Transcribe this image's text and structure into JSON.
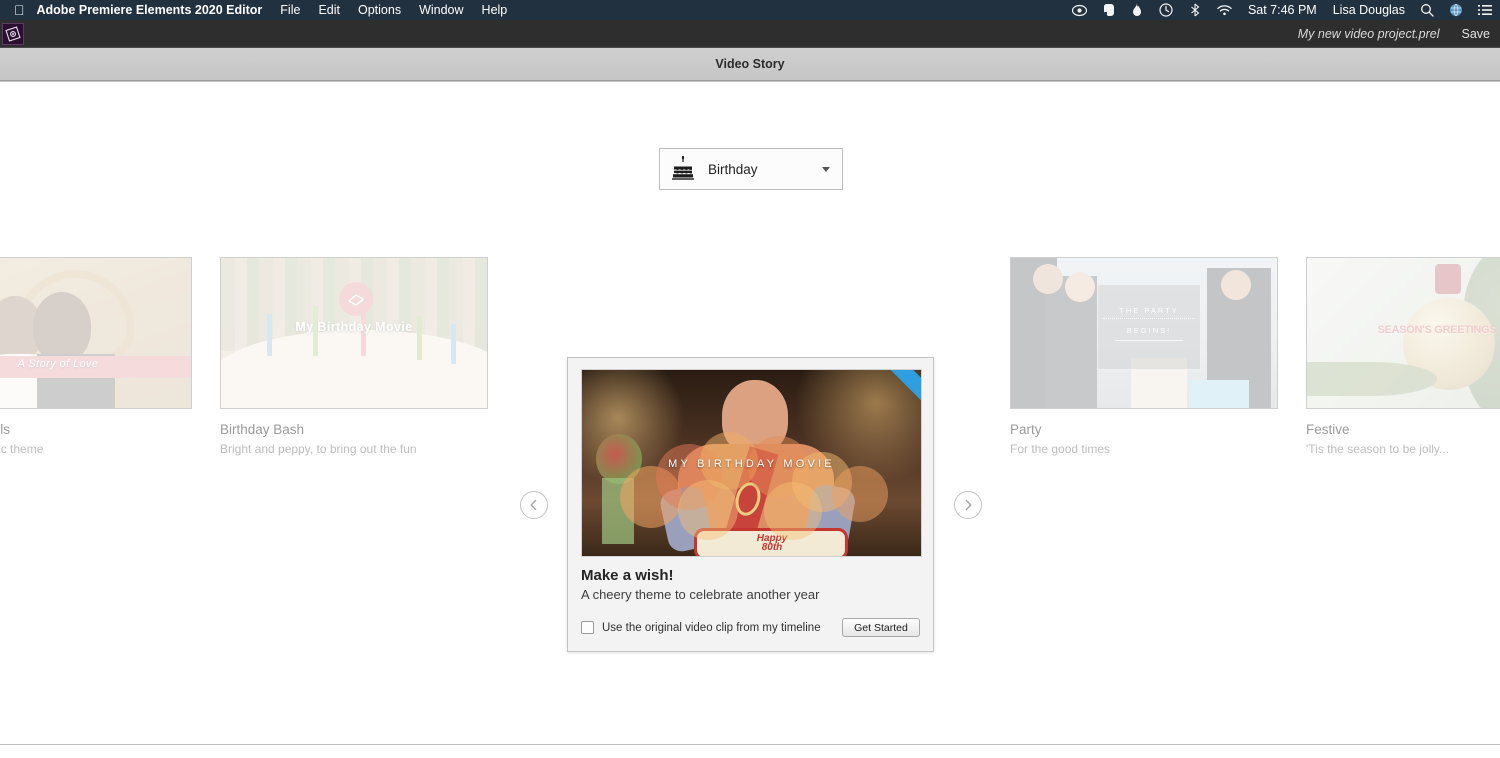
{
  "menubar": {
    "apple_icon": "apple-logo",
    "app_title": "Adobe Premiere Elements 2020 Editor",
    "menus": [
      "File",
      "Edit",
      "Options",
      "Window",
      "Help"
    ],
    "status_icons": [
      "creative-cloud-icon",
      "evernote-icon",
      "flame-icon",
      "time-machine-icon",
      "bluetooth-icon",
      "wifi-icon"
    ],
    "clock": "Sat 7:46 PM",
    "user": "Lisa Douglas",
    "trailing_icons": [
      "search-icon",
      "globe-icon",
      "notification-list-icon"
    ]
  },
  "titlebar": {
    "logo": "premiere-elements-logo",
    "project_name": "My new video project.prel",
    "save_label": "Save"
  },
  "panel": {
    "title": "Video Story"
  },
  "category": {
    "icon": "birthday-cake-icon",
    "value": "Birthday",
    "caret": "chevron-down-icon"
  },
  "nav": {
    "prev": "chevron-left-icon",
    "next": "chevron-right-icon"
  },
  "themes": [
    {
      "name": "Wedding Bells",
      "name_visible": "ells",
      "desc": "A very romantic theme",
      "desc_visible": "ry romantic theme",
      "overlay_text": "A Story of Love"
    },
    {
      "name": "Birthday Bash",
      "desc": "Bright and peppy, to bring out the fun",
      "overlay_text": "My Birthday Movie"
    },
    {
      "name": "Party",
      "desc": "For the good times",
      "overlay_text": "THE PARTY BEGINS!"
    },
    {
      "name": "Festive",
      "desc": "'Tis the season to be jolly...",
      "overlay_text": "SEASON'S GREETINGS !"
    }
  ],
  "featured": {
    "overlay_text": "MY BIRTHDAY MOVIE",
    "title": "Make a wish!",
    "desc": "A cheery theme to celebrate another year",
    "checkbox_label": "Use the original video clip from my timeline",
    "checkbox_checked": false,
    "button_label": "Get Started"
  },
  "colors": {
    "menubar_bg": "#22313f",
    "titlebar_bg": "#2e2e2e",
    "panel_bg": "#c8c8c8",
    "workspace_bg": "#ffffff",
    "accent_pink": "#d97a7e",
    "ribbon_blue": "#2f9ee0"
  }
}
